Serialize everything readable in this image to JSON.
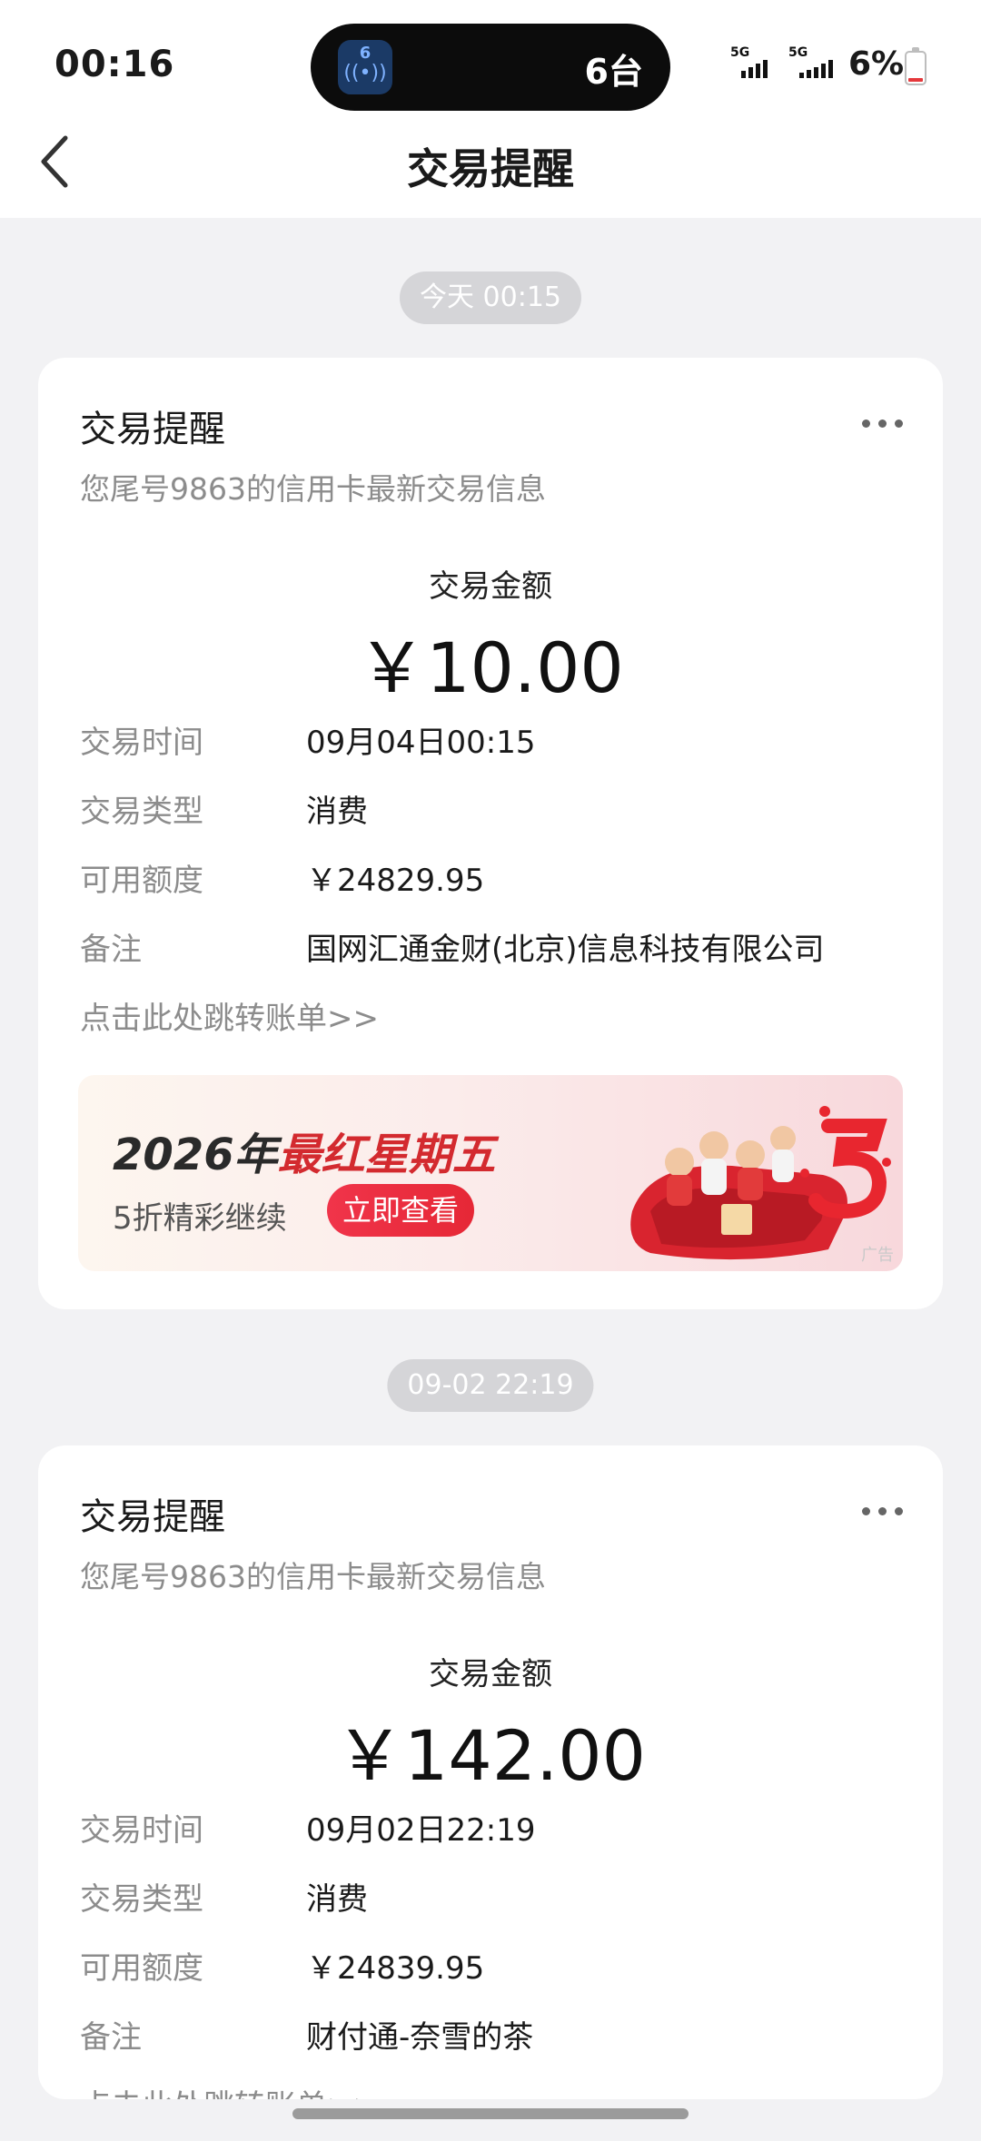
{
  "status_bar": {
    "time": "00:16",
    "island_count": "6台",
    "island_badge": "6",
    "net1": "5G",
    "net2": "5G",
    "battery": "6%"
  },
  "header": {
    "title": "交易提醒"
  },
  "messages": [
    {
      "timestamp": "今天 00:15",
      "title": "交易提醒",
      "subtitle": "您尾号9863的信用卡最新交易信息",
      "amount_label": "交易金额",
      "amount": "￥10.00",
      "rows": [
        {
          "k": "交易时间",
          "v": "09月04日00:15"
        },
        {
          "k": "交易类型",
          "v": "消费"
        },
        {
          "k": "可用额度",
          "v": "￥24829.95"
        },
        {
          "k": "备注",
          "v": "国网汇通金财(北京)信息科技有限公司"
        }
      ],
      "link": "点击此处跳转账单>>",
      "banner": {
        "year": "2026年",
        "headline": "最红星期五",
        "subtitle": "5折精彩继续",
        "button": "立即查看",
        "ad_label": "广告"
      }
    },
    {
      "timestamp": "09-02 22:19",
      "title": "交易提醒",
      "subtitle": "您尾号9863的信用卡最新交易信息",
      "amount_label": "交易金额",
      "amount": "￥142.00",
      "rows": [
        {
          "k": "交易时间",
          "v": "09月02日22:19"
        },
        {
          "k": "交易类型",
          "v": "消费"
        },
        {
          "k": "可用额度",
          "v": "￥24839.95"
        },
        {
          "k": "备注",
          "v": "财付通-奈雪的茶"
        }
      ],
      "link": "点击此处跳转账单>>"
    }
  ],
  "colors": {
    "accent_red": "#e62836",
    "background": "#f2f2f4",
    "muted_text": "#8c8c8c"
  }
}
